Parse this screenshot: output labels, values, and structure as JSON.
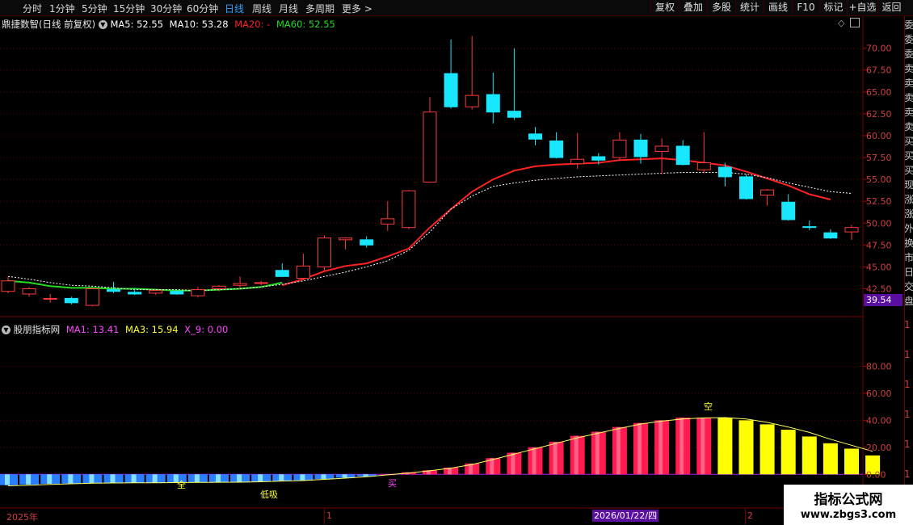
{
  "toolbar": {
    "periods": [
      "分时",
      "1分钟",
      "5分钟",
      "15分钟",
      "30分钟",
      "60分钟",
      "日线",
      "周线",
      "月线",
      "多周期",
      "更多 >"
    ],
    "active_period": "日线",
    "tools": [
      "复权",
      "叠加",
      "多股",
      "统计",
      "画线",
      "F10",
      "标记",
      "+自选",
      "返回"
    ]
  },
  "main_panel": {
    "stock_name": "鼎捷数智",
    "adjust_mode": "(日线 前复权)",
    "ma5": "MA5: 52.55",
    "ma10": "MA10: 53.28",
    "ma20": "MA20: -",
    "ma60": "MA60: 52.55",
    "current_price_tag": "39.54",
    "colors": {
      "ma5": "#ffffff",
      "ma10": "#ff2222",
      "ma20_label": "#ff2222",
      "ma60": "#22dd22",
      "up": "#ff3b3b",
      "down": "#19e6ff"
    }
  },
  "sub_panel": {
    "name": "股朋指标网",
    "ma1": "MA1: 13.41",
    "ma3": "MA3: 15.94",
    "x9": "X_9: 0.00",
    "signals": {
      "buy_full": "全",
      "low_buy": "低吸",
      "buy": "买",
      "short": "空"
    }
  },
  "bottom_axis": {
    "year_label": "2025年",
    "month_1": "1",
    "cursor_date": "2026/01/22/四",
    "month_2": "2"
  },
  "right_side": {
    "truncated_chars": [
      "委",
      "委",
      "委",
      "卖",
      "卖",
      "卖",
      "卖",
      "卖",
      "买",
      "买",
      "买",
      "现",
      "涨",
      "涨",
      "外",
      "换",
      "市",
      "日",
      "交",
      "盘",
      "1",
      "1",
      "1",
      "1",
      "1",
      "1"
    ]
  },
  "watermark": {
    "title": "指标公式网",
    "url": "www.zbgs3.com"
  },
  "chart_data": [
    {
      "type": "candlestick",
      "title": "鼎捷数智 日线 前复权",
      "y_ticks": [
        42.5,
        45.0,
        47.5,
        50.0,
        52.5,
        55.0,
        57.5,
        60.0,
        62.5,
        65.0,
        67.5,
        70.0
      ],
      "ylim": [
        39.5,
        72.0
      ],
      "candles": [
        {
          "o": 42.2,
          "h": 43.9,
          "l": 42.0,
          "c": 43.4
        },
        {
          "o": 41.9,
          "h": 42.7,
          "l": 41.6,
          "c": 42.5
        },
        {
          "o": 41.3,
          "h": 41.9,
          "l": 40.9,
          "c": 41.4
        },
        {
          "o": 41.4,
          "h": 41.6,
          "l": 40.7,
          "c": 40.9
        },
        {
          "o": 40.6,
          "h": 42.6,
          "l": 40.5,
          "c": 42.5
        },
        {
          "o": 42.4,
          "h": 43.3,
          "l": 42.0,
          "c": 42.2
        },
        {
          "o": 42.1,
          "h": 42.6,
          "l": 41.8,
          "c": 41.9
        },
        {
          "o": 42.0,
          "h": 42.3,
          "l": 41.8,
          "c": 42.3
        },
        {
          "o": 42.2,
          "h": 42.4,
          "l": 41.8,
          "c": 41.9
        },
        {
          "o": 41.7,
          "h": 42.7,
          "l": 41.5,
          "c": 42.4
        },
        {
          "o": 42.5,
          "h": 42.9,
          "l": 42.2,
          "c": 42.8
        },
        {
          "o": 42.9,
          "h": 43.9,
          "l": 42.6,
          "c": 43.1
        },
        {
          "o": 43.2,
          "h": 43.4,
          "l": 42.9,
          "c": 43.2
        },
        {
          "o": 44.6,
          "h": 45.4,
          "l": 43.9,
          "c": 43.9
        },
        {
          "o": 43.7,
          "h": 46.5,
          "l": 43.5,
          "c": 45.1
        },
        {
          "o": 45.0,
          "h": 48.6,
          "l": 44.6,
          "c": 48.3
        },
        {
          "o": 48.1,
          "h": 48.4,
          "l": 47.0,
          "c": 48.3
        },
        {
          "o": 48.1,
          "h": 48.5,
          "l": 47.2,
          "c": 47.5
        },
        {
          "o": 49.9,
          "h": 52.5,
          "l": 49.1,
          "c": 50.5
        },
        {
          "o": 49.5,
          "h": 53.8,
          "l": 49.3,
          "c": 53.7
        },
        {
          "o": 54.7,
          "h": 64.4,
          "l": 54.7,
          "c": 62.7
        },
        {
          "o": 67.1,
          "h": 71.0,
          "l": 63.1,
          "c": 63.3
        },
        {
          "o": 63.3,
          "h": 71.4,
          "l": 63.0,
          "c": 64.6
        },
        {
          "o": 64.7,
          "h": 67.2,
          "l": 61.4,
          "c": 62.7
        },
        {
          "o": 62.8,
          "h": 70.0,
          "l": 61.8,
          "c": 62.1
        },
        {
          "o": 60.2,
          "h": 61.0,
          "l": 58.9,
          "c": 59.6
        },
        {
          "o": 59.4,
          "h": 60.4,
          "l": 57.4,
          "c": 57.5
        },
        {
          "o": 56.8,
          "h": 60.3,
          "l": 56.2,
          "c": 57.3
        },
        {
          "o": 57.6,
          "h": 58.0,
          "l": 56.7,
          "c": 57.2
        },
        {
          "o": 57.5,
          "h": 60.4,
          "l": 57.2,
          "c": 59.5
        },
        {
          "o": 59.5,
          "h": 60.2,
          "l": 56.8,
          "c": 57.6
        },
        {
          "o": 58.2,
          "h": 59.7,
          "l": 55.6,
          "c": 58.8
        },
        {
          "o": 58.8,
          "h": 59.5,
          "l": 56.6,
          "c": 56.7
        },
        {
          "o": 56.1,
          "h": 60.4,
          "l": 55.7,
          "c": 56.9
        },
        {
          "o": 56.4,
          "h": 56.9,
          "l": 54.2,
          "c": 55.3
        },
        {
          "o": 55.3,
          "h": 55.6,
          "l": 52.7,
          "c": 52.8
        },
        {
          "o": 53.2,
          "h": 53.9,
          "l": 52.0,
          "c": 53.8
        },
        {
          "o": 52.4,
          "h": 53.3,
          "l": 50.3,
          "c": 50.4
        },
        {
          "o": 49.6,
          "h": 50.3,
          "l": 49.2,
          "c": 49.5
        },
        {
          "o": 48.9,
          "h": 49.3,
          "l": 48.2,
          "c": 48.3
        },
        {
          "o": 49.0,
          "h": 49.8,
          "l": 48.1,
          "c": 49.5
        }
      ],
      "series": [
        {
          "name": "MA10",
          "color": "#ff2222",
          "x_from": 13,
          "values": [
            42.9,
            43.6,
            44.5,
            45.1,
            45.4,
            46.2,
            47.1,
            49.5,
            51.6,
            53.6,
            55.0,
            56.0,
            56.5,
            56.7,
            56.8,
            56.9,
            57.2,
            57.3,
            57.4,
            57.2,
            56.9,
            56.6,
            55.9,
            55.1,
            54.3,
            53.3,
            52.7
          ]
        },
        {
          "name": "MA60",
          "color": "#22dd22",
          "x_from": 0,
          "x_to": 13,
          "values": [
            43.4,
            43.2,
            42.8,
            42.6,
            42.6,
            42.5,
            42.5,
            42.4,
            42.3,
            42.3,
            42.4,
            42.5,
            42.7,
            43.2
          ]
        },
        {
          "name": "MA5",
          "color": "#ffffff",
          "dashed": true,
          "values": [
            43.9,
            43.6,
            43.2,
            42.9,
            42.8,
            42.6,
            42.4,
            42.4,
            42.4,
            42.3,
            42.4,
            42.5,
            42.7,
            43.0,
            43.4,
            43.9,
            44.4,
            45.0,
            45.7,
            46.9,
            49.0,
            51.6,
            53.1,
            54.2,
            54.6,
            54.9,
            55.1,
            55.3,
            55.4,
            55.5,
            55.6,
            55.7,
            55.8,
            55.8,
            55.8,
            55.6,
            55.2,
            54.6,
            54.1,
            53.6,
            53.4
          ]
        }
      ]
    },
    {
      "type": "bar",
      "title": "股朋指标网",
      "y_ticks": [
        0.0,
        20.0,
        40.0,
        60.0,
        80.0
      ],
      "ylim": [
        -10.0,
        100.0
      ],
      "values": [
        -8.0,
        -7.5,
        -7.0,
        -6.8,
        -6.5,
        -6.5,
        -6.4,
        -6.4,
        -6.2,
        -6.0,
        -6.0,
        -6.0,
        -5.5,
        -5.0,
        -4.5,
        -3.5,
        -2.5,
        -1.5,
        0.0,
        1.5,
        3.0,
        5.0,
        8.0,
        12.0,
        16.0,
        20.0,
        24.0,
        28.5,
        31.5,
        35.0,
        38.0,
        40.0,
        42.0,
        42.0,
        42.0,
        40.0,
        37.0,
        33.0,
        28.0,
        23.0,
        19.0,
        14.0
      ],
      "colors": {
        "negative": "#2a7fff",
        "rising": "#ff1a50",
        "falling": "#ffff00"
      },
      "line_values": [
        -8.5,
        -8.0,
        -7.4,
        -7.0,
        -6.6,
        -6.4,
        -6.3,
        -6.3,
        -6.1,
        -6.0,
        -5.9,
        -5.8,
        -5.5,
        -5.0,
        -4.6,
        -3.7,
        -2.8,
        -1.8,
        -0.4,
        1.0,
        2.6,
        4.6,
        7.3,
        11.0,
        15.0,
        19.0,
        23.0,
        27.0,
        30.5,
        34.0,
        37.2,
        39.4,
        41.0,
        41.8,
        42.0,
        41.0,
        38.5,
        35.0,
        31.0,
        26.0,
        21.5,
        17.0
      ]
    }
  ]
}
